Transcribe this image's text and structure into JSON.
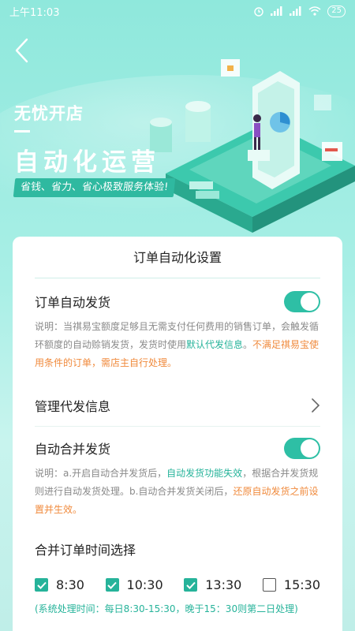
{
  "status": {
    "time": "上午11:03",
    "battery": "25"
  },
  "hero": {
    "brand": "无忧开店",
    "headline": "自动化运营",
    "slogan": "省钱、省力、省心极致服务体验!"
  },
  "card": {
    "title": "订单自动化设置",
    "auto_ship": {
      "label": "订单自动发货",
      "enabled": true,
      "desc_1": "说明：当祺易宝额度足够且无需支付任何费用的销售订单，会触发循环额度的自动赊销发货，发货时使用",
      "desc_link": "默认代发信息",
      "desc_2": "。",
      "desc_warn": "不满足祺易宝使用条件的订单，需店主自行处理。"
    },
    "manage": {
      "label": "管理代发信息"
    },
    "auto_merge": {
      "label": "自动合并发货",
      "enabled": true,
      "desc_1": "说明：a.开启自动合并发货后，",
      "desc_link": "自动发货功能失效",
      "desc_2": "，根据合并发货规则进行自动发货处理。b.自动合并发货关闭后，",
      "desc_warn": "还原自动发货之前设置并生效。"
    },
    "merge_time": {
      "label": "合并订单时间选择",
      "options": [
        {
          "label": "8:30",
          "checked": true
        },
        {
          "label": "10:30",
          "checked": true
        },
        {
          "label": "13:30",
          "checked": true
        },
        {
          "label": "15:30",
          "checked": false
        }
      ],
      "note": "(系统处理时间：每日8:30-15:30，晚于15：30则第二日处理)"
    }
  },
  "colors": {
    "accent": "#26b39a",
    "warn": "#f08a3c",
    "toggle_on": "#2ebfa5"
  },
  "icons": [
    "back-arrow-icon",
    "alarm-icon",
    "signal-icon",
    "wifi-icon",
    "chevron-right-icon",
    "check-icon"
  ]
}
